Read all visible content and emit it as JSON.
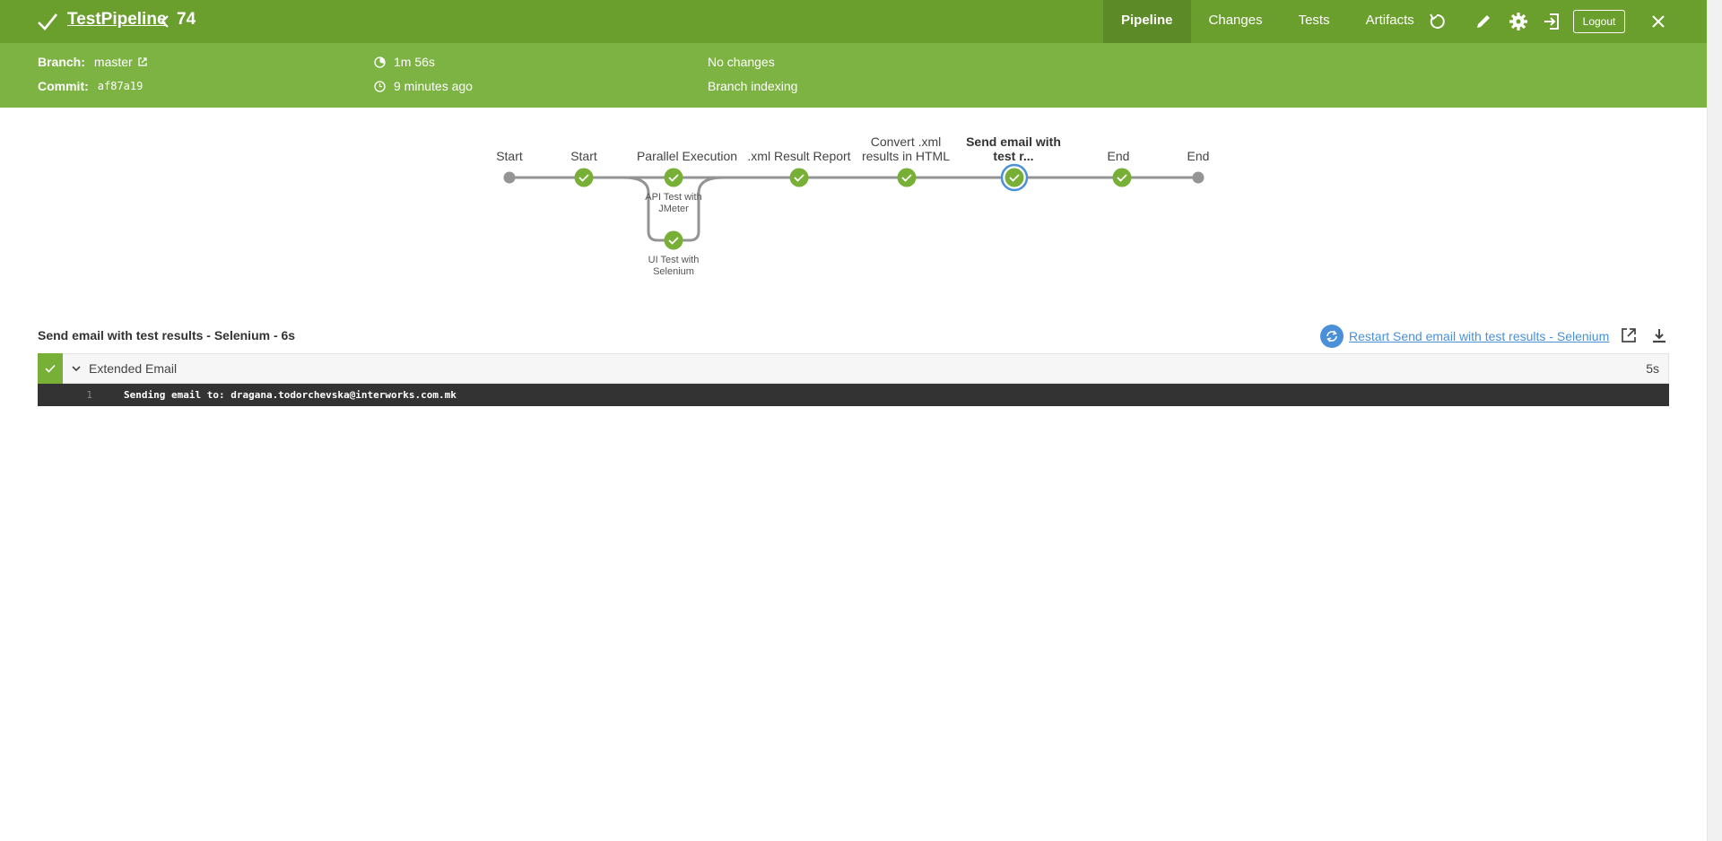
{
  "header": {
    "pipeline_name": "TestPipeline",
    "run_number": "74",
    "tabs": [
      {
        "label": "Pipeline",
        "active": true
      },
      {
        "label": "Changes",
        "active": false
      },
      {
        "label": "Tests",
        "active": false
      },
      {
        "label": "Artifacts",
        "active": false
      }
    ],
    "logout_label": "Logout",
    "icons": [
      "rerun-icon",
      "edit-icon",
      "gear-icon",
      "exit-icon",
      "close-icon"
    ]
  },
  "info": {
    "branch_label": "Branch:",
    "branch_value": "master",
    "commit_label": "Commit:",
    "commit_value": "af87a19",
    "duration": "1m 56s",
    "time_ago": "9 minutes ago",
    "changes": "No changes",
    "cause": "Branch indexing"
  },
  "graph": {
    "stages": [
      {
        "label": "Start",
        "status": "none"
      },
      {
        "label": "Start",
        "status": "success"
      },
      {
        "label": "Parallel Execution",
        "status": "success"
      },
      {
        "label": ".xml Result Report",
        "status": "success"
      },
      {
        "label_line1": "Convert .xml",
        "label_line2": "results in HTML",
        "status": "success"
      },
      {
        "label_line1": "Send email with",
        "label_line2": "test r...",
        "status": "success",
        "selected": true
      },
      {
        "label": "End",
        "status": "success"
      },
      {
        "label": "End",
        "status": "none"
      }
    ],
    "parallel_branches": [
      {
        "line1": "API Test with",
        "line2": "JMeter",
        "status": "success"
      },
      {
        "line1": "UI Test with",
        "line2": "Selenium",
        "status": "success"
      }
    ]
  },
  "step": {
    "title": "Send email with test results - Selenium - 6s",
    "restart_label": "Restart Send email with test results - Selenium",
    "row": {
      "name": "Extended Email",
      "duration": "5s",
      "status": "success"
    },
    "log": [
      {
        "line": "1",
        "text": "Sending email to: dragana.todorchevska@interworks.com.mk"
      }
    ]
  },
  "colors": {
    "header_bg": "#6a9f2e",
    "infobar_bg": "#7cb342",
    "success": "#78b037",
    "link": "#4a90d9"
  }
}
